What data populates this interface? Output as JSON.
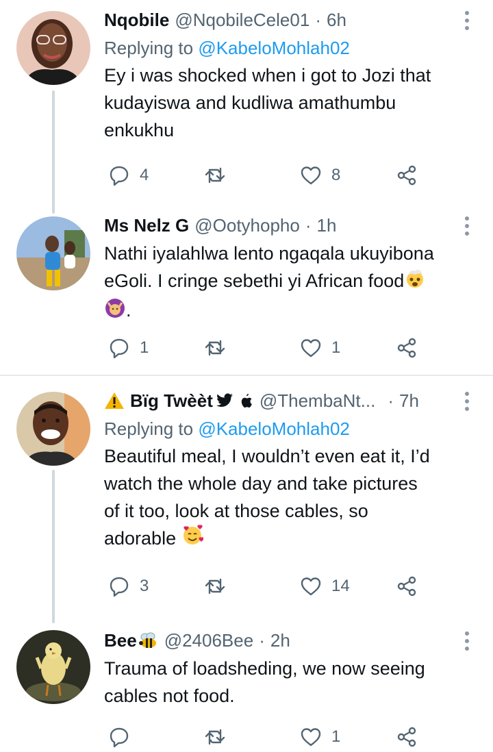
{
  "tweets": [
    {
      "name": "Nqobile",
      "handle": "@NqobileCele01",
      "separator": "·",
      "time": "6h",
      "reply_prefix": "Replying to",
      "reply_to": "@KabeloMohlah02",
      "text_lines": [
        "Ey i was shocked when i got to Jozi that",
        "kudayiswa and kudliwa amathumbu",
        "enkukhu"
      ],
      "replies": "4",
      "retweets": "",
      "likes": "8"
    },
    {
      "name": "Ms Nelz G",
      "handle": "@Ootyhopho",
      "separator": "·",
      "time": "1h",
      "text_lines": [
        "Nathi iyalahlwa lento ngaqala ukuyibona",
        "eGoli. I cringe sebethi yi African food",
        "."
      ],
      "replies": "1",
      "retweets": "",
      "likes": "1"
    },
    {
      "name": "Bïg Twèèt",
      "handle": "@ThembaNt...",
      "separator": "·",
      "time": "7h",
      "reply_prefix": "Replying to",
      "reply_to": "@KabeloMohlah02",
      "text_lines": [
        "Beautiful meal, I wouldn’t even eat it, I’d",
        "watch the whole day and take pictures",
        "of it too, look at those cables, so",
        "adorable"
      ],
      "replies": "3",
      "retweets": "",
      "likes": "14"
    },
    {
      "name": "Bee",
      "handle": "@2406Bee",
      "separator": "·",
      "time": "2h",
      "text_lines": [
        "Trauma of loadsheding, we now seeing",
        "cables not food."
      ],
      "replies": "",
      "retweets": "",
      "likes": "1"
    }
  ],
  "icons": {
    "reply": "reply-icon",
    "retweet": "retweet-icon",
    "like": "heart-icon",
    "share": "share-icon",
    "more": "more-vertical-icon"
  },
  "colors": {
    "link": "#1d9bf0",
    "secondary": "#536471",
    "thread_line": "#cfd9de",
    "warning": "#f4b400"
  }
}
